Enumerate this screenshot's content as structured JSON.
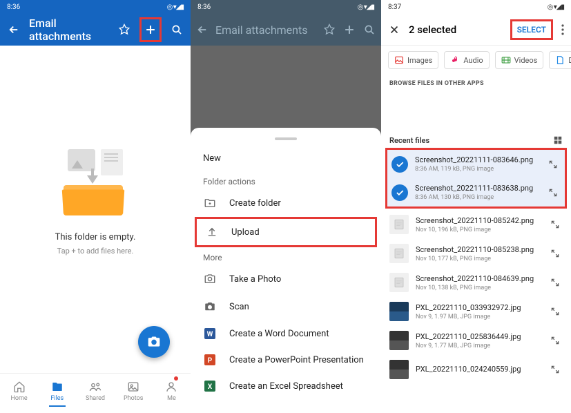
{
  "panel1": {
    "status": {
      "time": "8:36",
      "icons": "◎ ▾◢▮"
    },
    "header": {
      "title": "Email attachments"
    },
    "empty": {
      "line1": "This folder is empty.",
      "line2": "Tap + to add files here."
    },
    "nav": {
      "home": "Home",
      "files": "Files",
      "shared": "Shared",
      "photos": "Photos",
      "me": "Me"
    }
  },
  "panel2": {
    "status": {
      "time": "8:36",
      "icons": "◎ ▾◢▮"
    },
    "header": {
      "title": "Email attachments"
    },
    "sheet": {
      "new": "New",
      "folder_actions": "Folder actions",
      "create_folder": "Create folder",
      "upload": "Upload",
      "more": "More",
      "take_photo": "Take a Photo",
      "scan": "Scan",
      "word": "Create a Word Document",
      "ppt": "Create a PowerPoint Presentation",
      "xls": "Create an Excel Spreadsheet"
    }
  },
  "panel3": {
    "status": {
      "time": "8:37",
      "icons": "◎ ▾◢▮"
    },
    "header": {
      "title": "2 selected",
      "select": "SELECT"
    },
    "chips": {
      "images": "Images",
      "audio": "Audio",
      "videos": "Videos",
      "docs": "Docur"
    },
    "browse_other": "BROWSE FILES IN OTHER APPS",
    "recent": "Recent files",
    "files": [
      {
        "name": "Screenshot_20221111-083646.png",
        "meta": "8:36 AM, 119 kB, PNG image",
        "selected": true
      },
      {
        "name": "Screenshot_20221111-083638.png",
        "meta": "8:36 AM, 130 kB, PNG image",
        "selected": true
      },
      {
        "name": "Screenshot_20221110-085242.png",
        "meta": "Nov 10, 196 kB, PNG image",
        "selected": false
      },
      {
        "name": "Screenshot_20221110-085238.png",
        "meta": "Nov 10, 177 kB, PNG image",
        "selected": false
      },
      {
        "name": "Screenshot_20221110-084639.png",
        "meta": "Nov 10, 138 kB, PNG image",
        "selected": false
      },
      {
        "name": "PXL_20221110_033932972.jpg",
        "meta": "Nov 9, 1.97 MB, JPG image",
        "selected": false,
        "photo": 1
      },
      {
        "name": "PXL_20221110_025836449.jpg",
        "meta": "Nov 9, 1.77 MB, JPG image",
        "selected": false,
        "photo": 2
      },
      {
        "name": "PXL_20221110_024240559.jpg",
        "meta": "",
        "selected": false,
        "photo": 2
      }
    ]
  }
}
